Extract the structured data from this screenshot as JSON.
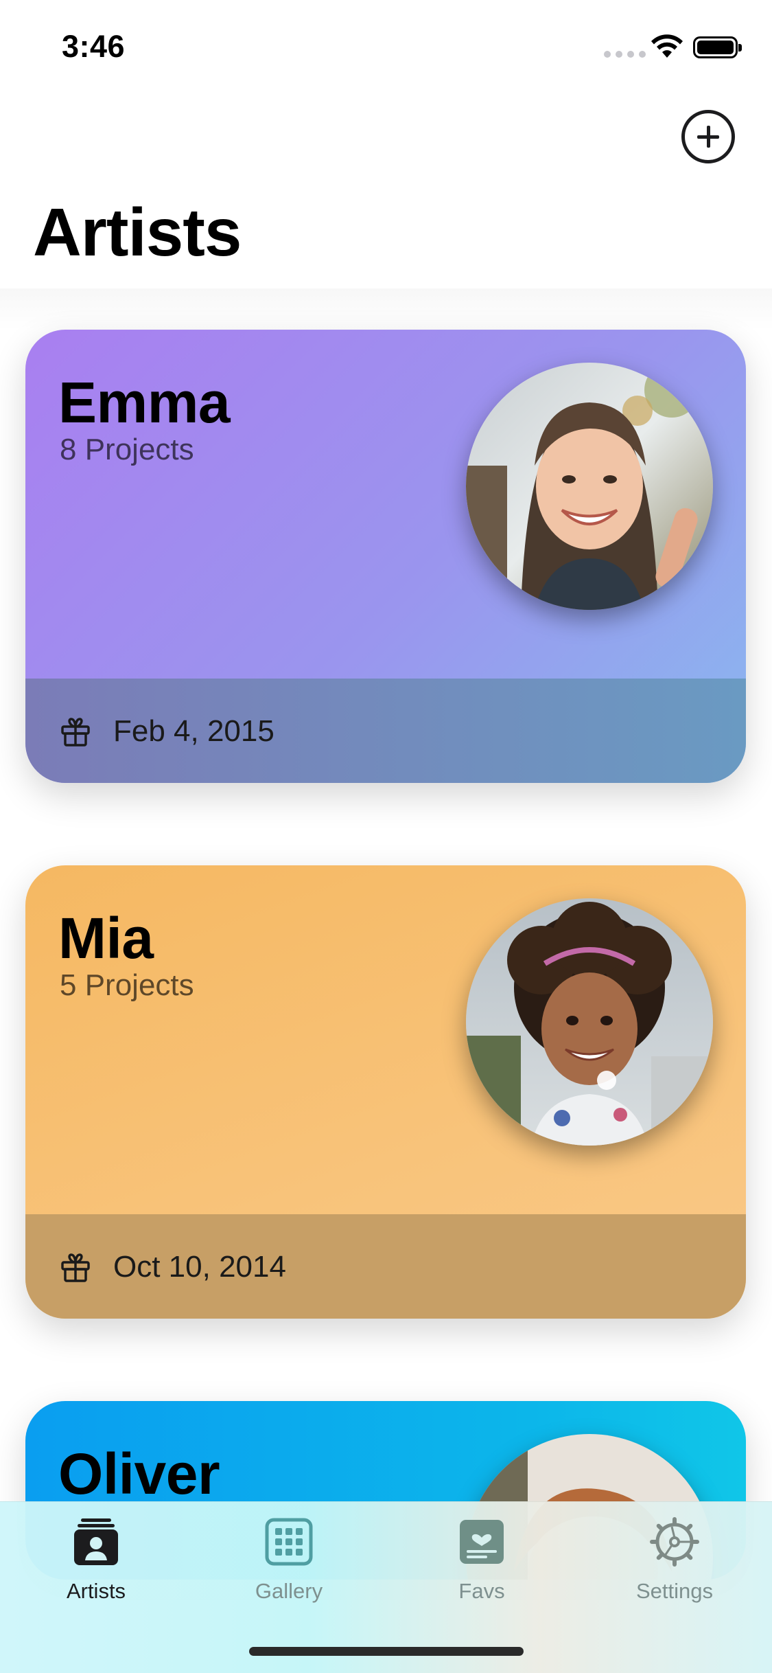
{
  "status_bar": {
    "time": "3:46",
    "icons": [
      "cellular-signal-icon",
      "wifi-icon",
      "battery-icon"
    ]
  },
  "header": {
    "title": "Artists",
    "add_icon": "plus-circle-icon"
  },
  "artists": [
    {
      "name": "Emma",
      "projects": "8 Projects",
      "birthday": "Feb 4, 2015",
      "avatar": "avatar-photo",
      "color": "#a97ff0"
    },
    {
      "name": "Mia",
      "projects": "5 Projects",
      "birthday": "Oct 10, 2014",
      "avatar": "avatar-photo",
      "color": "#f5b862"
    },
    {
      "name": "Oliver",
      "avatar": "avatar-photo",
      "color": "#0a9ef0"
    }
  ],
  "tab_bar": {
    "tabs": [
      {
        "label": "Artists",
        "icon": "person-card-stack-icon",
        "active": true
      },
      {
        "label": "Gallery",
        "icon": "grid-icon",
        "active": false
      },
      {
        "label": "Favs",
        "icon": "heart-card-icon",
        "active": false
      },
      {
        "label": "Settings",
        "icon": "gear-icon",
        "active": false
      }
    ],
    "active_color": "#1c1c1e",
    "inactive_color": "#7e908f"
  }
}
